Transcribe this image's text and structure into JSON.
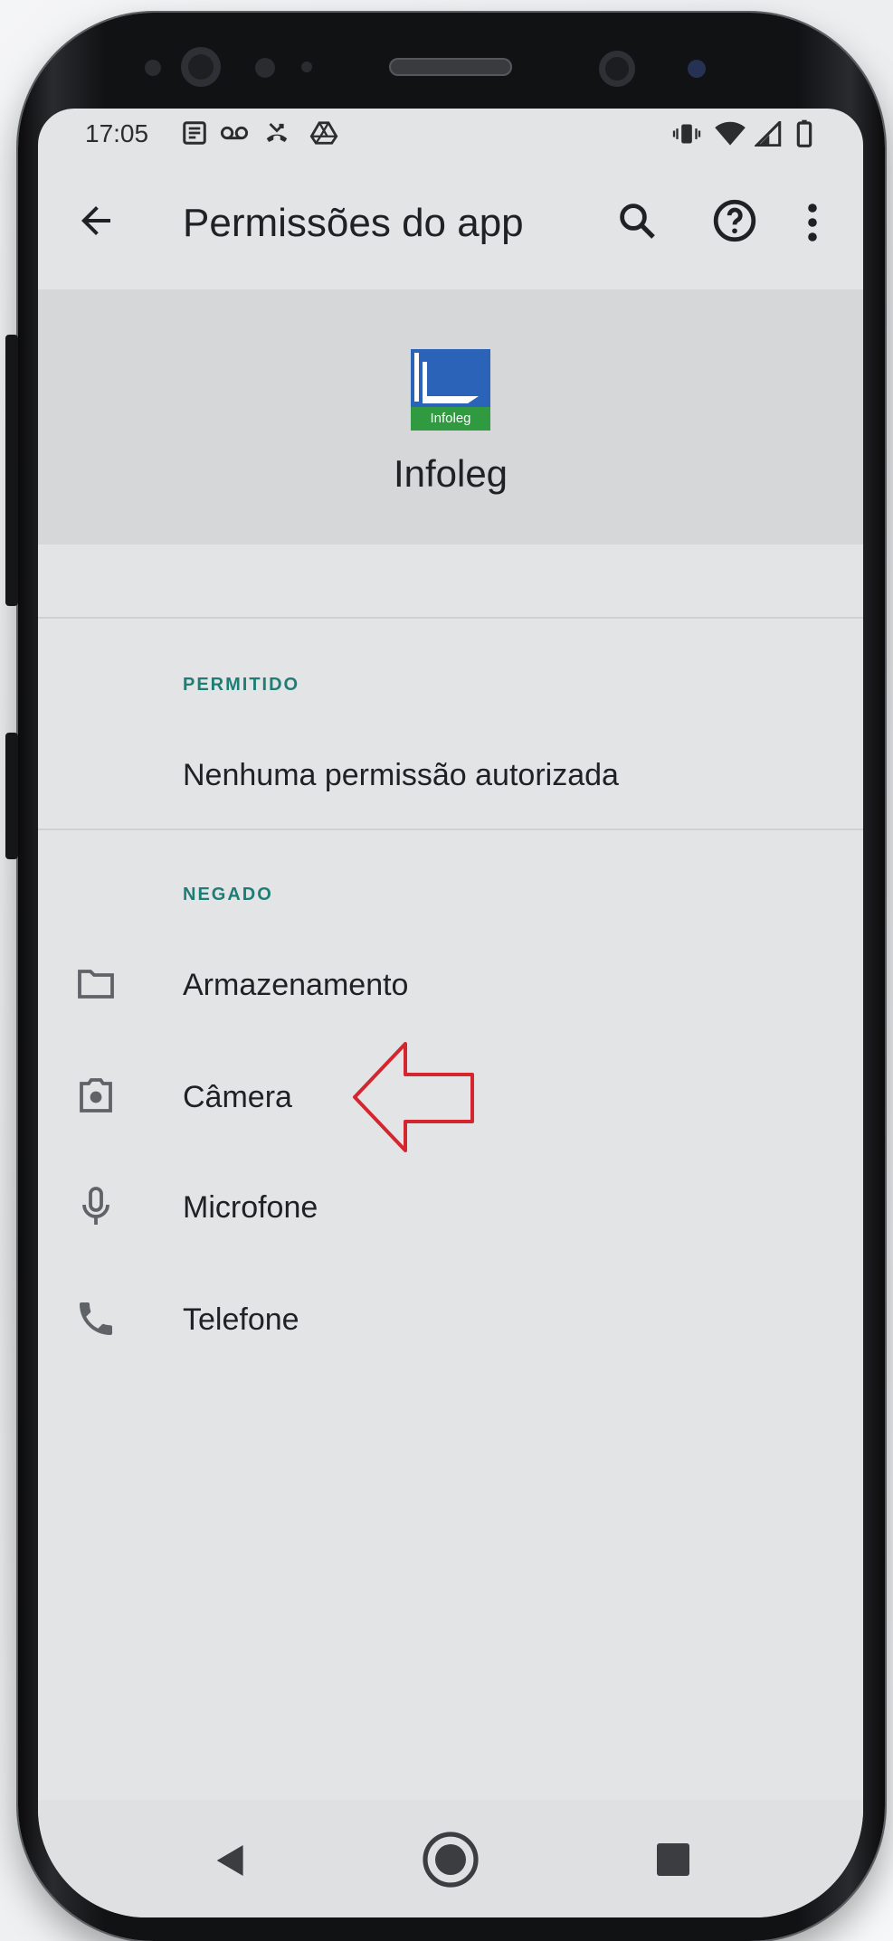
{
  "status_bar": {
    "time": "17:05",
    "left_icons": [
      "news-icon",
      "voicemail-icon",
      "missed-call-icon",
      "drive-icon"
    ],
    "right_icons": [
      "vibrate-icon",
      "wifi-icon",
      "signal-icon",
      "battery-icon"
    ]
  },
  "app_bar": {
    "title": "Permissões do app",
    "actions": [
      "back-icon",
      "search-icon",
      "help-icon",
      "more-vert-icon"
    ]
  },
  "app_header": {
    "name": "Infoleg",
    "logo_text": "Infoleg"
  },
  "sections": {
    "allowed": {
      "title": "PERMITIDO",
      "empty_text": "Nenhuma permissão autorizada"
    },
    "denied": {
      "title": "NEGADO",
      "items": [
        {
          "label": "Armazenamento",
          "icon": "folder-icon"
        },
        {
          "label": "Câmera",
          "icon": "camera-icon"
        },
        {
          "label": "Microfone",
          "icon": "microphone-icon"
        },
        {
          "label": "Telefone",
          "icon": "phone-icon"
        }
      ]
    }
  },
  "navigation_bar": [
    "back-nav-icon",
    "home-nav-icon",
    "recents-nav-icon"
  ],
  "colors": {
    "section_header": "#1e7d74",
    "annotation_arrow": "#d3262e",
    "logo_blue": "#2b63b8",
    "logo_green": "#2f9a3f"
  }
}
